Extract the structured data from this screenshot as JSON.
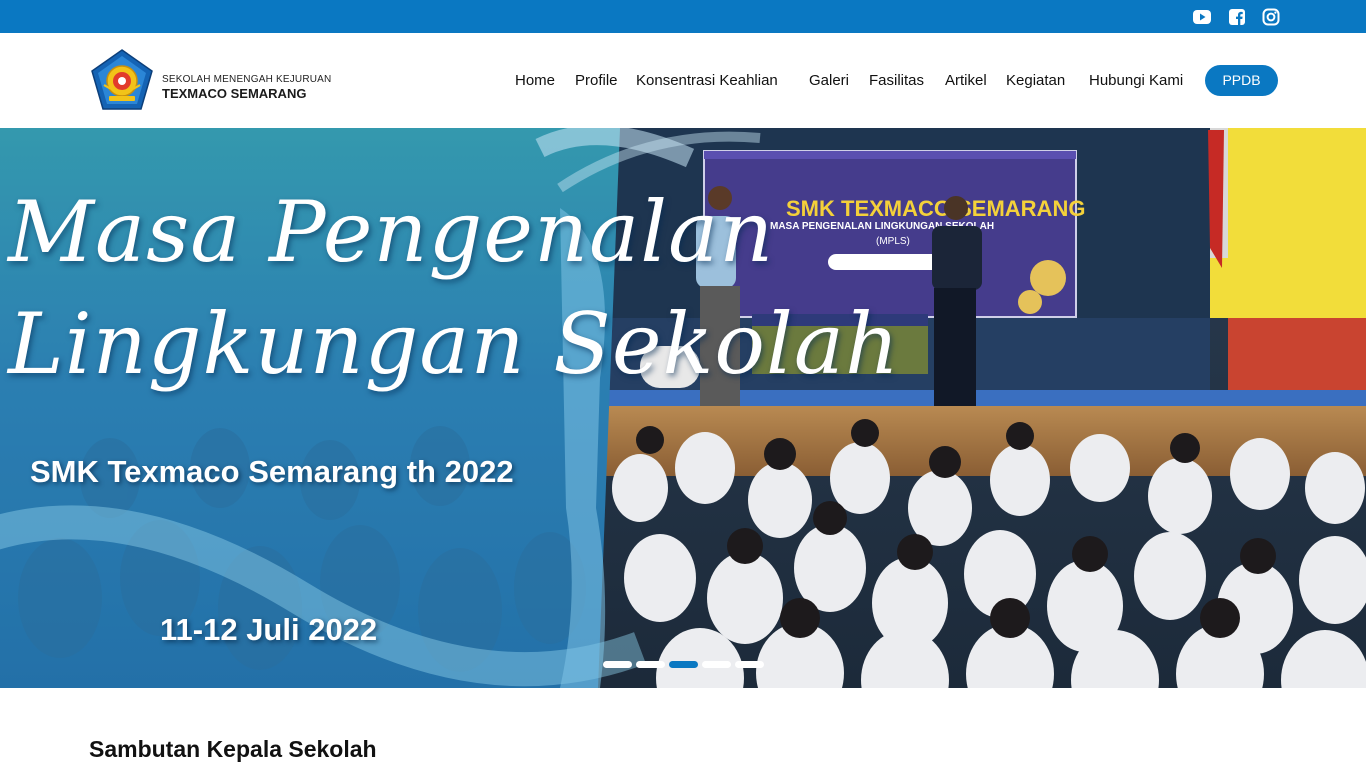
{
  "topbar": {
    "social": [
      {
        "icon": "youtube-icon"
      },
      {
        "icon": "facebook-icon"
      },
      {
        "icon": "instagram-icon"
      }
    ]
  },
  "logo": {
    "line1": "SEKOLAH MENENGAH KEJURUAN",
    "line2": "TEXMACO SEMARANG"
  },
  "nav": {
    "items": [
      {
        "label": "Home"
      },
      {
        "label": "Profile"
      },
      {
        "label": "Konsentrasi Keahlian"
      },
      {
        "label": "Galeri"
      },
      {
        "label": "Fasilitas"
      },
      {
        "label": "Artikel"
      },
      {
        "label": "Kegiatan"
      },
      {
        "label": "Hubungi Kami"
      }
    ],
    "cta": "PPDB"
  },
  "hero": {
    "title_line1": "Masa Pengenalan",
    "title_line2": "Lingkungan Sekolah",
    "subtitle": "SMK Texmaco Semarang th 2022",
    "date": "11-12 Juli 2022",
    "banner_title": "SMK TEXMACO SEMARANG",
    "banner_sub": "MASA PENGENALAN LINGKUNGAN SEKOLAH",
    "banner_tag": "(MPLS)",
    "slides_total": 5,
    "active_slide": 3
  },
  "section": {
    "title": "Sambutan Kepala Sekolah"
  },
  "colors": {
    "brand": "#0a78c2",
    "text": "#111111",
    "white": "#ffffff"
  }
}
